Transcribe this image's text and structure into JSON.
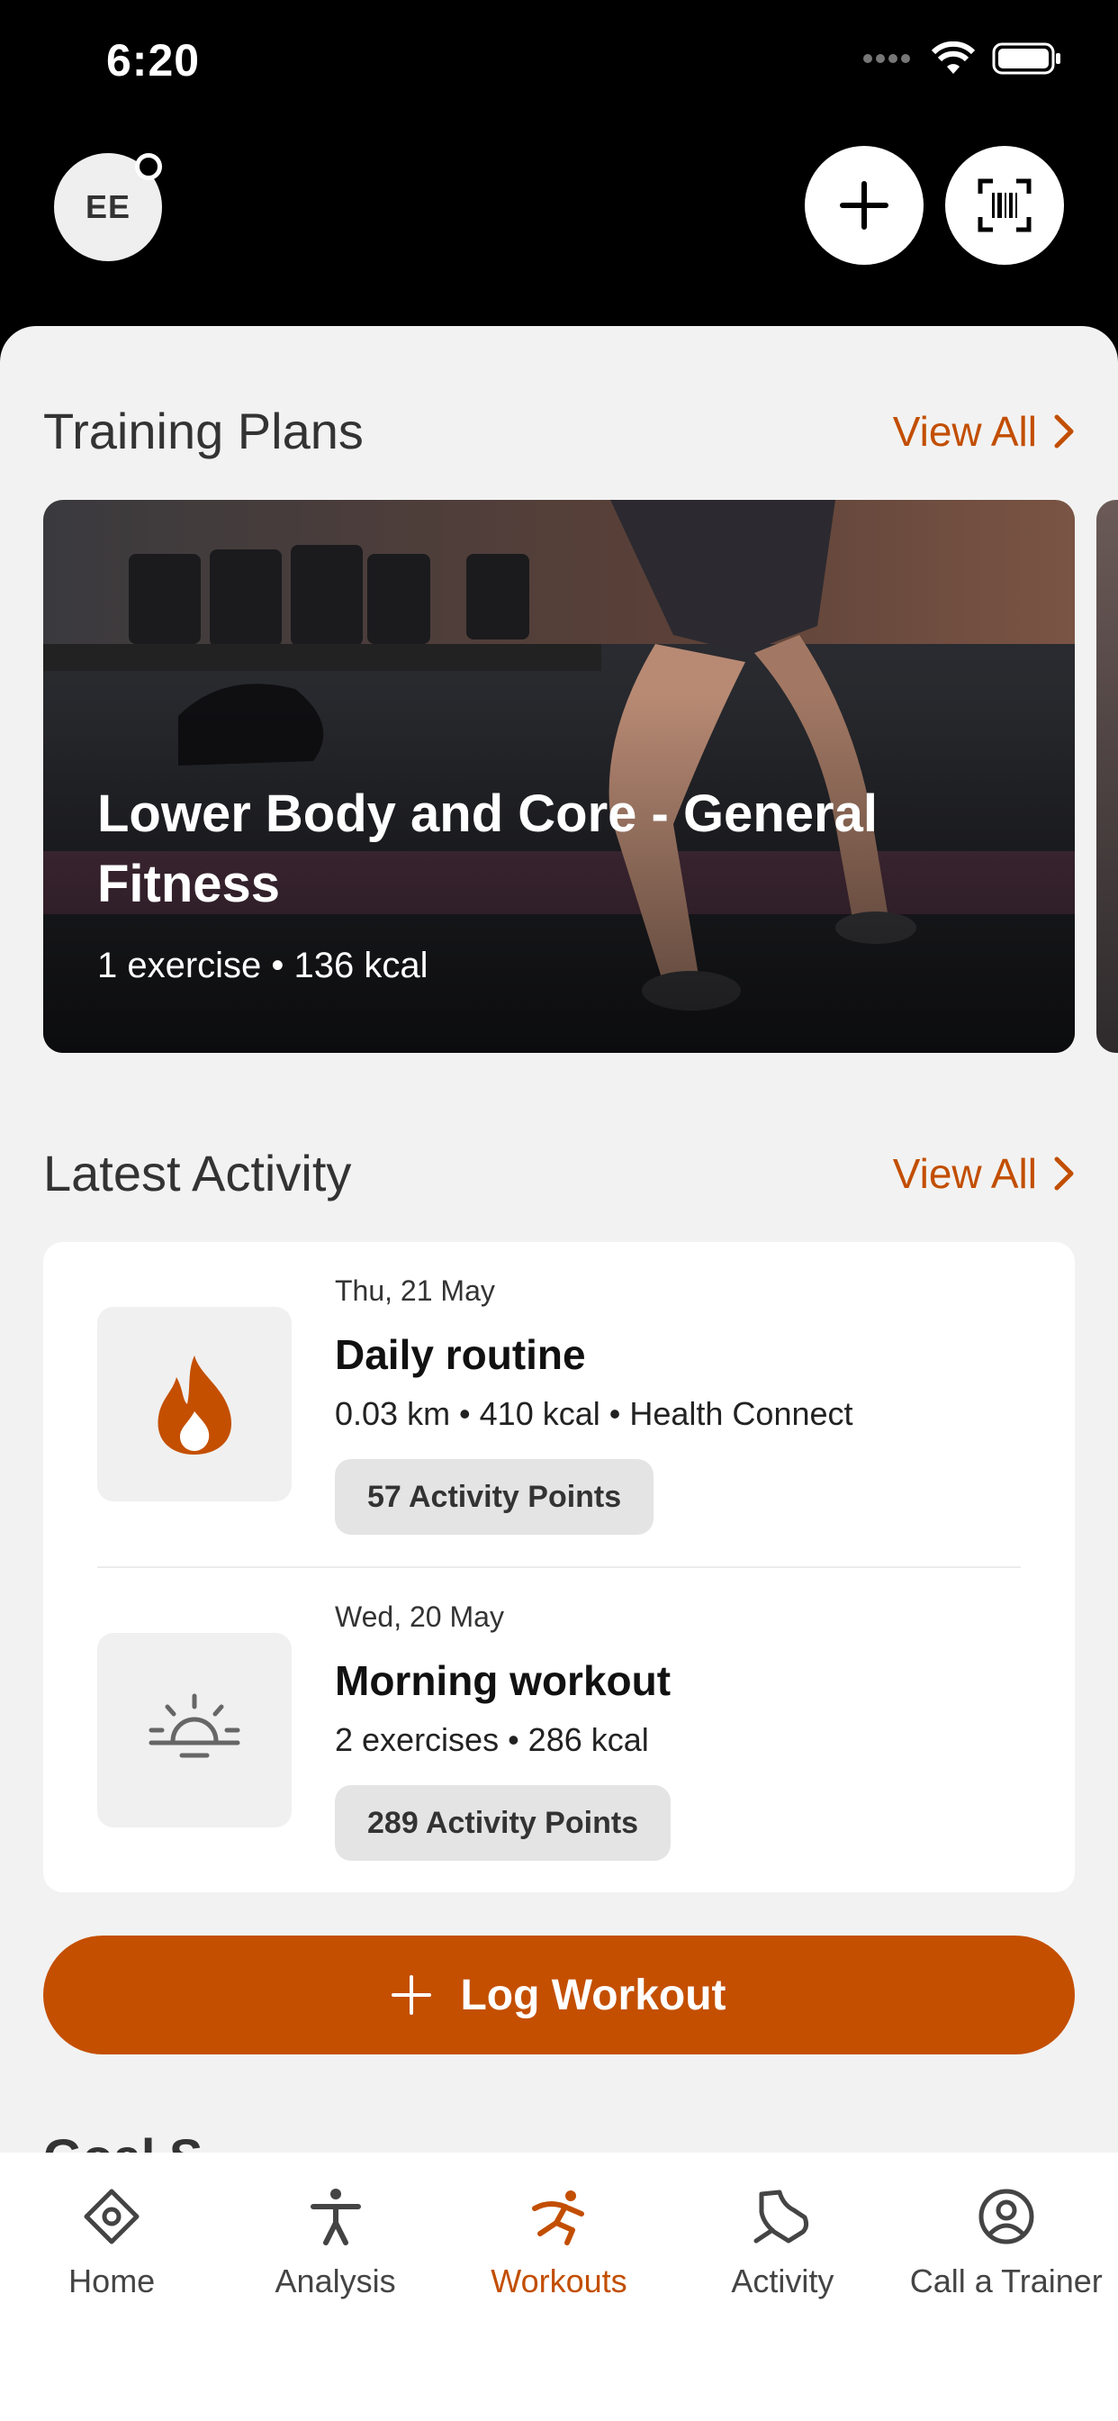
{
  "status_bar": {
    "time": "6:20"
  },
  "header": {
    "avatar_initials": "EE"
  },
  "training_plans": {
    "title": "Training Plans",
    "view_all": "View All",
    "card": {
      "title": "Lower Body and Core - General Fitness",
      "meta": "1 exercise • 136 kcal"
    }
  },
  "latest_activity": {
    "title": "Latest Activity",
    "view_all": "View All",
    "items": [
      {
        "date": "Thu, 21 May",
        "title": "Daily routine",
        "meta": "0.03 km • 410 kcal • Health Connect",
        "points": "57 Activity Points",
        "icon": "flame-icon"
      },
      {
        "date": "Wed, 20 May",
        "title": "Morning workout",
        "meta": "2 exercises • 286 kcal",
        "points": "289 Activity Points",
        "icon": "sunrise-icon"
      }
    ]
  },
  "log_workout": {
    "label": "Log Workout"
  },
  "cut_off_heading": "Goal S",
  "tab_bar": {
    "items": [
      {
        "label": "Home",
        "icon": "home-icon",
        "active": false
      },
      {
        "label": "Analysis",
        "icon": "person-icon",
        "active": false
      },
      {
        "label": "Workouts",
        "icon": "running-icon",
        "active": true
      },
      {
        "label": "Activity",
        "icon": "shoe-icon",
        "active": false
      },
      {
        "label": "Call a Trainer",
        "icon": "trainer-icon",
        "active": false
      }
    ]
  },
  "colors": {
    "accent": "#c44f00",
    "background": "#f2f2f2",
    "header": "#000000"
  }
}
